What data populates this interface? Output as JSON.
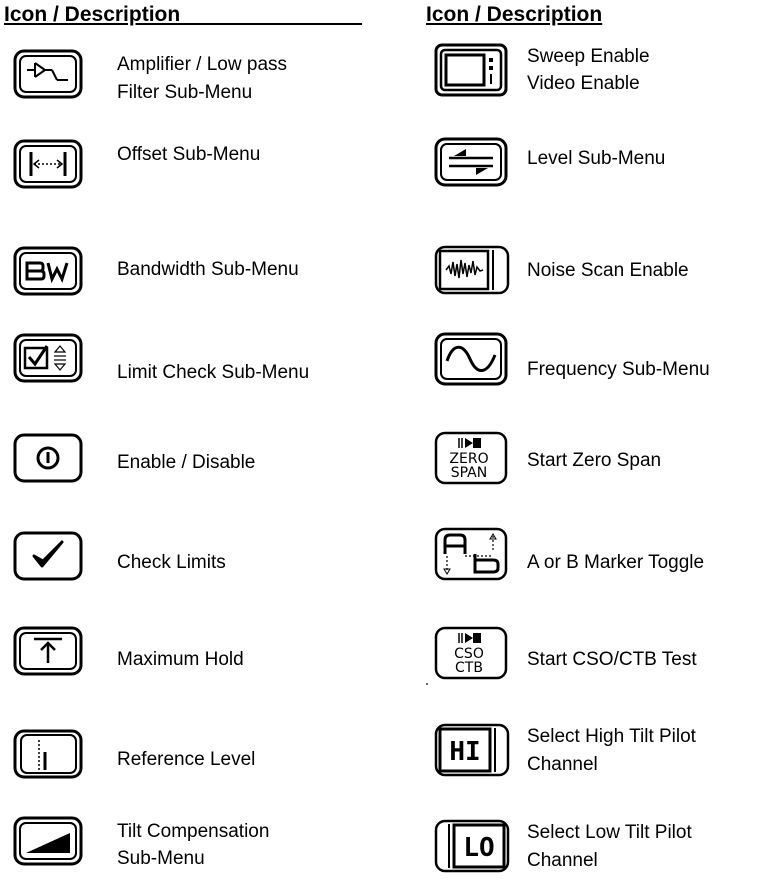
{
  "headers": {
    "left": "Icon / Description",
    "right": "Icon  / Description"
  },
  "left_items": [
    {
      "icon": "amplifier-lowpass-filter-icon",
      "lines": [
        "Amplifier / Low pass",
        "Filter Sub-Menu"
      ]
    },
    {
      "icon": "offset-icon",
      "lines": [
        "Offset Sub-Menu"
      ]
    },
    {
      "icon": "bandwidth-icon",
      "lines": [
        "Bandwidth Sub-Menu"
      ]
    },
    {
      "icon": "limit-check-icon",
      "lines": [
        "Limit Check Sub-Menu"
      ]
    },
    {
      "icon": "power-icon",
      "lines": [
        "Enable / Disable"
      ]
    },
    {
      "icon": "checkmark-icon",
      "lines": [
        "Check Limits"
      ]
    },
    {
      "icon": "max-hold-icon",
      "lines": [
        "Maximum Hold"
      ]
    },
    {
      "icon": "reference-level-icon",
      "lines": [
        "Reference Level"
      ]
    },
    {
      "icon": "tilt-compensation-icon",
      "lines": [
        "Tilt Compensation",
        "Sub-Menu"
      ]
    }
  ],
  "right_items": [
    {
      "icon": "tv-monitor-icon",
      "lines": [
        "Sweep Enable",
        "Video Enable"
      ]
    },
    {
      "icon": "level-icon",
      "lines": [
        "Level Sub-Menu"
      ]
    },
    {
      "icon": "noise-scan-icon",
      "lines": [
        "Noise Scan Enable"
      ]
    },
    {
      "icon": "sine-wave-icon",
      "lines": [
        "Frequency Sub-Menu"
      ]
    },
    {
      "icon": "zero-span-icon",
      "lines": [
        "Start Zero Span"
      ],
      "icon_text": [
        "ZERO",
        "SPAN"
      ]
    },
    {
      "icon": "ab-marker-icon",
      "lines": [
        "A or B Marker Toggle"
      ],
      "icon_text": [
        "A",
        "B"
      ]
    },
    {
      "icon": "cso-ctb-icon",
      "lines": [
        "Start CSO/CTB Test"
      ],
      "icon_text": [
        "CSO",
        "CTB"
      ]
    },
    {
      "icon": "hi-icon",
      "lines": [
        "Select High Tilt Pilot",
        "Channel"
      ],
      "icon_text": [
        "HI"
      ]
    },
    {
      "icon": "lo-icon",
      "lines": [
        "Select Low Tilt Pilot",
        "Channel"
      ],
      "icon_text": [
        "LO"
      ]
    }
  ],
  "bandwidth_icon_text": "BW"
}
